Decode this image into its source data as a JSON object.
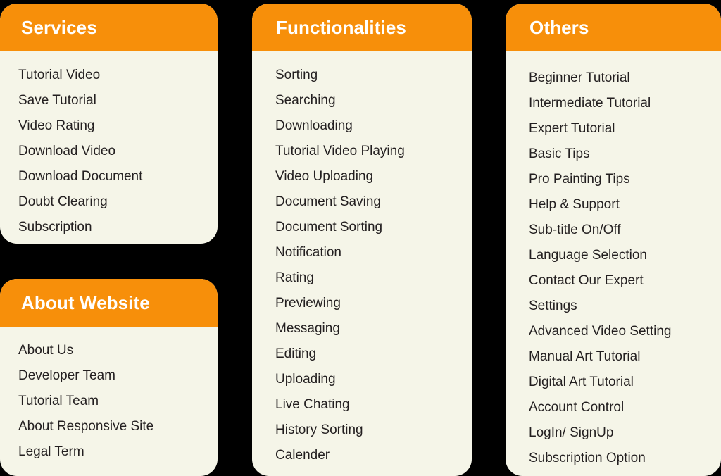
{
  "theme": {
    "background": "#000000",
    "header_orange": "#F78F0A",
    "card_cream": "#F5F5E8",
    "header_text": "#FFFFFF",
    "body_text": "#231F20"
  },
  "cards": [
    {
      "id": "services",
      "title": "Services",
      "items": [
        "Tutorial Video",
        "Save Tutorial",
        "Video Rating",
        "Download Video",
        "Download Document",
        "Doubt Clearing",
        "Subscription"
      ]
    },
    {
      "id": "about-website",
      "title": "About Website",
      "items": [
        "About Us",
        "Developer Team",
        "Tutorial Team",
        "About Responsive Site",
        "Legal Term"
      ]
    },
    {
      "id": "functionalities",
      "title": "Functionalities",
      "items": [
        "Sorting",
        "Searching",
        "Downloading",
        "Tutorial Video Playing",
        "Video Uploading",
        "Document Saving",
        "Document Sorting",
        "Notification",
        "Rating",
        "Previewing",
        "Messaging",
        "Editing",
        "Uploading",
        "Live Chating",
        "History Sorting",
        "Calender"
      ]
    },
    {
      "id": "others",
      "title": "Others",
      "items": [
        "Beginner Tutorial",
        "Intermediate Tutorial",
        "Expert Tutorial",
        "Basic Tips",
        "Pro Painting Tips",
        "Help & Support",
        "Sub-title On/Off",
        "Language Selection",
        "Contact Our Expert",
        "Settings",
        "Advanced Video Setting",
        "Manual Art Tutorial",
        "Digital Art Tutorial",
        "Account Control",
        "LogIn/ SignUp",
        "Subscription Option"
      ]
    }
  ]
}
